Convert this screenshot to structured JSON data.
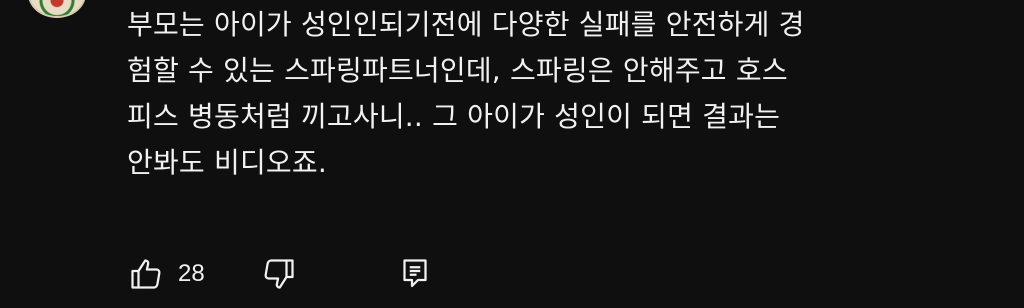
{
  "comment": {
    "lines": [
      "부모는 아이가 성인인되기전에 다양한 실패를 안전하게 경",
      "험할 수 있는 스파링파트너인데, 스파링은 안해주고 호스",
      "피스 병동처럼 끼고사니.. 그 아이가 성인이 되면 결과는",
      "안봐도 비디오죠."
    ]
  },
  "actions": {
    "like_count": "28",
    "like_icon": "thumbs-up-icon",
    "dislike_icon": "thumbs-down-icon",
    "reply_icon": "reply-comment-icon"
  },
  "colors": {
    "background": "#0f0f0f",
    "text": "#f1f1f1"
  }
}
